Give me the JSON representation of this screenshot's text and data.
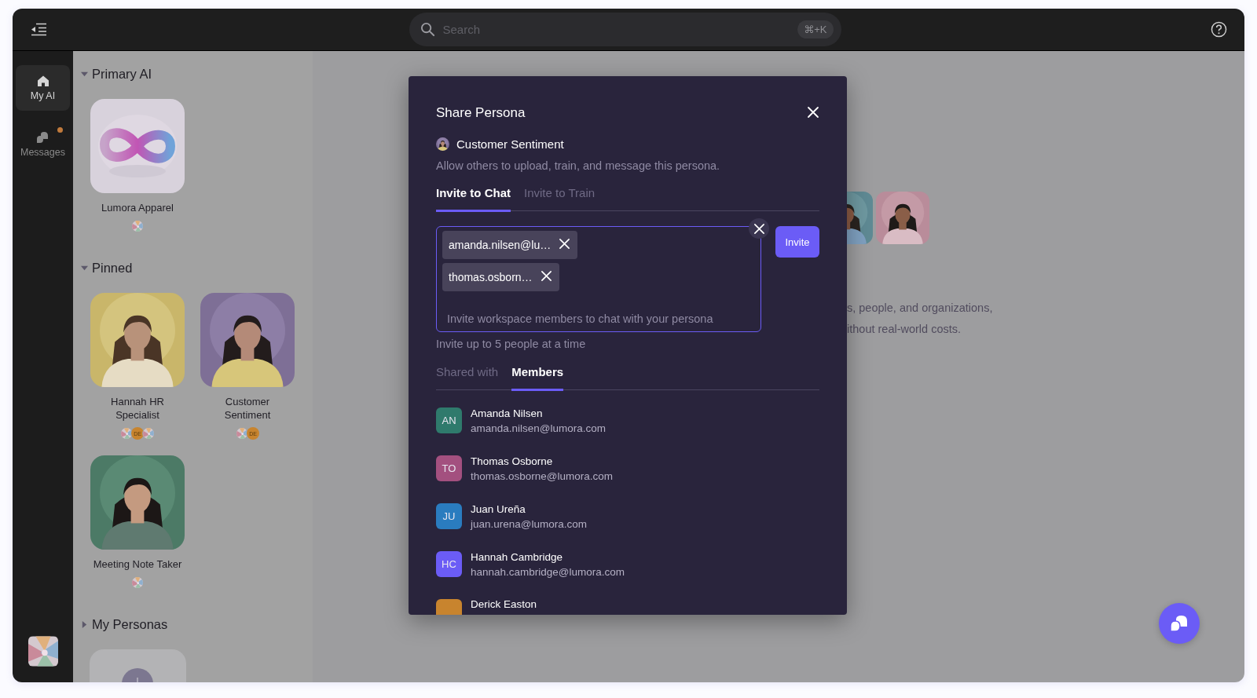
{
  "topbar": {
    "search": {
      "placeholder": "Search",
      "shortcut": "⌘+K"
    }
  },
  "rail": {
    "items": [
      {
        "kind": "home",
        "label": "My AI",
        "selected": true,
        "unread": false
      },
      {
        "kind": "messages",
        "label": "Messages",
        "selected": false,
        "unread": true
      }
    ]
  },
  "sidebar": {
    "sections": [
      {
        "title": "Primary AI",
        "expanded": true,
        "cards": [
          {
            "kind": "logo",
            "name": "Lumora Apparel",
            "avatars": [
              {
                "kind": "picture"
              }
            ]
          }
        ]
      },
      {
        "title": "Pinned",
        "expanded": true,
        "cards": [
          {
            "name": "Hannah HR Specialist",
            "avatars": [
              {
                "kind": "picture"
              },
              {
                "kind": "initials",
                "text": "DE"
              },
              {
                "kind": "picture"
              }
            ]
          },
          {
            "name": "Customer Sentiment",
            "avatars": [
              {
                "kind": "picture"
              },
              {
                "kind": "initials",
                "text": "DE"
              }
            ]
          },
          {
            "name": "Meeting Note Taker",
            "avatars": [
              {
                "kind": "picture"
              }
            ]
          }
        ]
      },
      {
        "title": "My Personas",
        "expanded": false,
        "cards": [
          {
            "kind": "add"
          }
        ]
      }
    ]
  },
  "main": {
    "text_lines": [
      "s, people, and organizations,",
      "ithout real-world costs."
    ]
  },
  "modal": {
    "title": "Share Persona",
    "persona": "Customer Sentiment",
    "description": "Allow others to upload, train, and message this persona.",
    "invite_tabs": [
      {
        "label": "Invite to Chat",
        "selected": true
      },
      {
        "label": "Invite to Train",
        "selected": false
      }
    ],
    "chips": [
      "amanda.nilsen@lu…",
      "thomas.osborn…"
    ],
    "placeholder": "Invite workspace members to chat with your persona",
    "invite_button": "Invite",
    "hint": "Invite up to 5 people at a time",
    "list_tabs": [
      {
        "label": "Shared with",
        "selected": false
      },
      {
        "label": "Members",
        "selected": true
      }
    ],
    "members": [
      {
        "initials": "AN",
        "name": "Amanda Nilsen",
        "email": "amanda.nilsen@lumora.com",
        "color": "#2f7a6c"
      },
      {
        "initials": "TO",
        "name": "Thomas Osborne",
        "email": "thomas.osborne@lumora.com",
        "color": "#a3507f"
      },
      {
        "initials": "JU",
        "name": "Juan Ureña",
        "email": "juan.urena@lumora.com",
        "color": "#2a7cbf"
      },
      {
        "initials": "HC",
        "name": "Hannah Cambridge",
        "email": "hannah.cambridge@lumora.com",
        "color": "#6b5cf6"
      },
      {
        "name": "Derick Easton",
        "color": "#c8842e"
      }
    ]
  }
}
